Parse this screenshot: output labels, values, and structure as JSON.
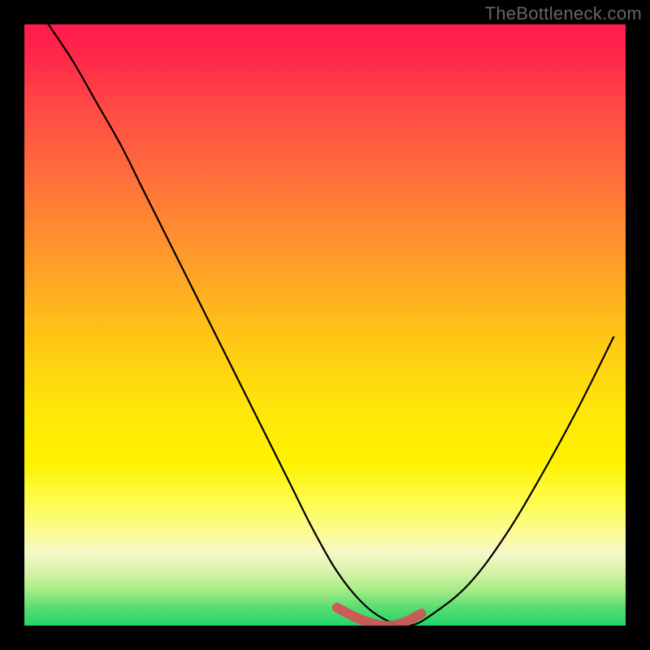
{
  "watermark": "TheBottleneck.com",
  "colors": {
    "frame_bg": "#000000",
    "gradient_top": "#ff1a4d",
    "gradient_mid_orange": "#ff8b30",
    "gradient_mid_yellow": "#ffe808",
    "gradient_bottom": "#22d56a",
    "curve": "#000000",
    "highlight": "#d05555"
  },
  "chart_data": {
    "type": "line",
    "title": "",
    "xlabel": "",
    "ylabel": "",
    "xlim": [
      0,
      100
    ],
    "ylim": [
      0,
      100
    ],
    "axes": "hidden",
    "grid": false,
    "legend": null,
    "background": {
      "style": "vertical-gradient",
      "stops": [
        {
          "pos": 0,
          "color": "#ff1a4d"
        },
        {
          "pos": 14,
          "color": "#ff4a45"
        },
        {
          "pos": 34,
          "color": "#ff8b30"
        },
        {
          "pos": 55,
          "color": "#ffcf12"
        },
        {
          "pos": 73,
          "color": "#fff200"
        },
        {
          "pos": 88,
          "color": "#f5f8c9"
        },
        {
          "pos": 97,
          "color": "#59dd6f"
        },
        {
          "pos": 100,
          "color": "#22d56a"
        }
      ]
    },
    "series": [
      {
        "name": "bottleneck-curve",
        "color": "#000000",
        "x": [
          4,
          8,
          12,
          16,
          20,
          24,
          28,
          32,
          36,
          40,
          44,
          48,
          52,
          56,
          60,
          64,
          68,
          74,
          80,
          86,
          92,
          98
        ],
        "y": [
          100,
          94,
          87,
          80,
          72,
          64,
          56,
          48,
          40,
          32,
          24,
          16,
          9,
          4,
          1,
          0,
          2,
          7,
          15,
          25,
          36,
          48
        ]
      }
    ],
    "highlight_segment": {
      "description": "near-minimum flat region",
      "color": "#d05555",
      "x": [
        52,
        56,
        60,
        63,
        66
      ],
      "y": [
        3,
        1,
        0,
        0.5,
        2
      ]
    },
    "annotations": []
  }
}
